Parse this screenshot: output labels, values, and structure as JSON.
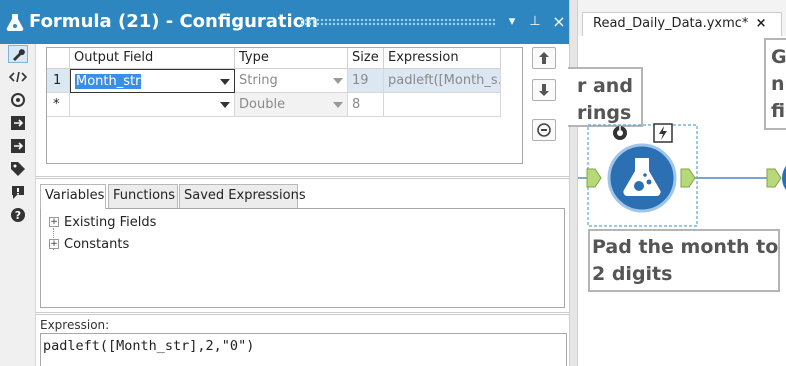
{
  "window": {
    "title": "Formula (21) - Configuration",
    "controls": [
      "▾",
      "⊥",
      "×"
    ]
  },
  "sidebar": {
    "icons": [
      "wrench-icon",
      "code-icon",
      "tool-icon",
      "input-icon",
      "output-icon",
      "tag-icon",
      "warning-icon",
      "help-icon"
    ]
  },
  "grid": {
    "headers": {
      "output_field": "Output Field",
      "type": "Type",
      "size": "Size",
      "expression": "Expression"
    },
    "rows": [
      {
        "num": "1",
        "output_field": "Month_str",
        "type": "String",
        "size": "19",
        "expression": "padleft([Month_s..."
      },
      {
        "num": "*",
        "output_field": "",
        "type": "Double",
        "size": "8",
        "expression": ""
      }
    ],
    "side_buttons": [
      "move-up",
      "move-down",
      "delete"
    ]
  },
  "tabs": [
    "Variables",
    "Functions",
    "Saved Expressions"
  ],
  "tree": [
    "Existing Fields",
    "Constants"
  ],
  "expression": {
    "label": "Expression:",
    "value": "padleft([Month_str],2,\"0\")"
  },
  "canvas": {
    "tab_title": "Read_Daily_Data.yxmc*",
    "tab_close": "×",
    "comment_left_lines": [
      "r and",
      "rings"
    ],
    "comment_right_lines": [
      "Gr",
      "nu",
      "fie"
    ],
    "comment_bottom_lines": [
      "Pad the month to",
      "2 digits"
    ],
    "colors": {
      "accent": "#2e86c1",
      "tool_blue": "#2c6fb3",
      "anchor_green": "#b8d97a"
    }
  }
}
